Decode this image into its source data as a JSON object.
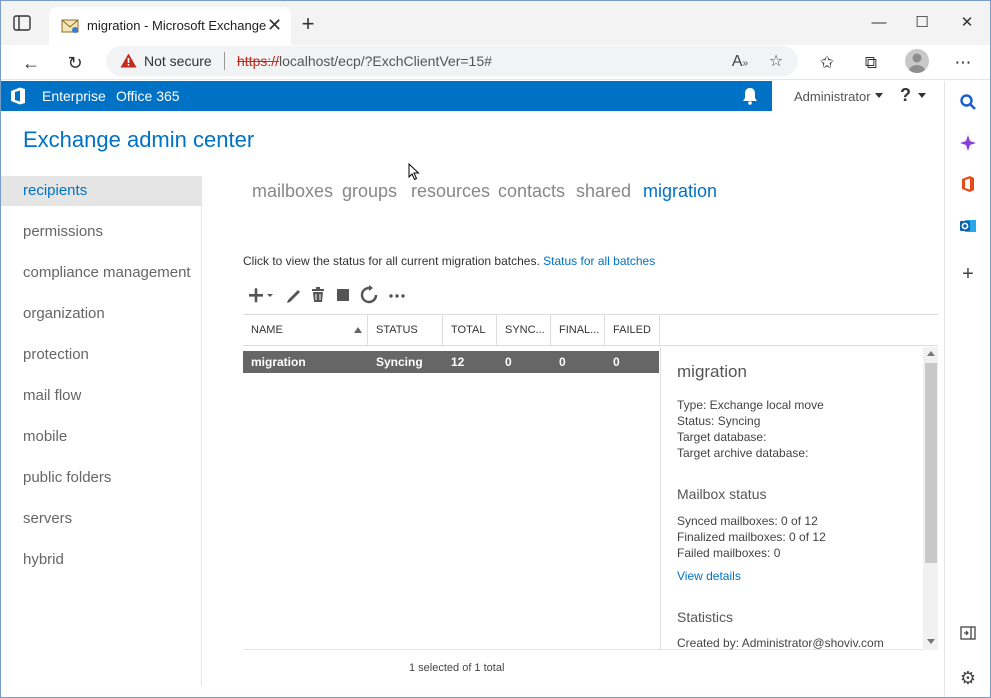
{
  "browser": {
    "tab_title": "migration - Microsoft Exchange",
    "not_secure": "Not secure",
    "url_scheme": "https://",
    "url_rest": "localhost/ecp/?ExchClientVer=15#"
  },
  "eac_bar": {
    "enterprise": "Enterprise",
    "office365": "Office 365",
    "user": "Administrator",
    "help": "?"
  },
  "title": "Exchange admin center",
  "left_nav": {
    "items": [
      {
        "label": "recipients"
      },
      {
        "label": "permissions"
      },
      {
        "label": "compliance management"
      },
      {
        "label": "organization"
      },
      {
        "label": "protection"
      },
      {
        "label": "mail flow"
      },
      {
        "label": "mobile"
      },
      {
        "label": "public folders"
      },
      {
        "label": "servers"
      },
      {
        "label": "hybrid"
      }
    ]
  },
  "subtabs": {
    "items": [
      {
        "label": "mailboxes"
      },
      {
        "label": "groups"
      },
      {
        "label": "resources"
      },
      {
        "label": "contacts"
      },
      {
        "label": "shared"
      },
      {
        "label": "migration"
      }
    ]
  },
  "info": {
    "text": "Click to view the status for all current migration batches.",
    "link": "Status for all batches"
  },
  "toolbar": {
    "icons": [
      "add-icon",
      "edit-icon",
      "delete-icon",
      "stop-icon",
      "refresh-icon",
      "more-icon"
    ]
  },
  "table": {
    "columns": [
      "NAME",
      "STATUS",
      "TOTAL",
      "SYNC...",
      "FINAL...",
      "FAILED"
    ],
    "row": {
      "name": "migration",
      "status": "Syncing",
      "total": "12",
      "synced": "0",
      "finalized": "0",
      "failed": "0"
    }
  },
  "detail": {
    "title": "migration",
    "type": "Type: Exchange local move",
    "status": "Status: Syncing",
    "target_db": "Target database:",
    "target_archive": "Target archive database:",
    "mailbox_status_heading": "Mailbox status",
    "synced": "Synced mailboxes: 0 of 12",
    "finalized": "Finalized mailboxes: 0 of 12",
    "failed": "Failed mailboxes: 0",
    "view_details": "View details",
    "statistics_heading": "Statistics",
    "created_by": "Created by: Administrator@shoviv.com"
  },
  "footer": {
    "count": "1 selected of 1 total"
  },
  "colors": {
    "accent": "#0072c6",
    "row_selected": "#666666",
    "warning": "#c42b1c"
  }
}
